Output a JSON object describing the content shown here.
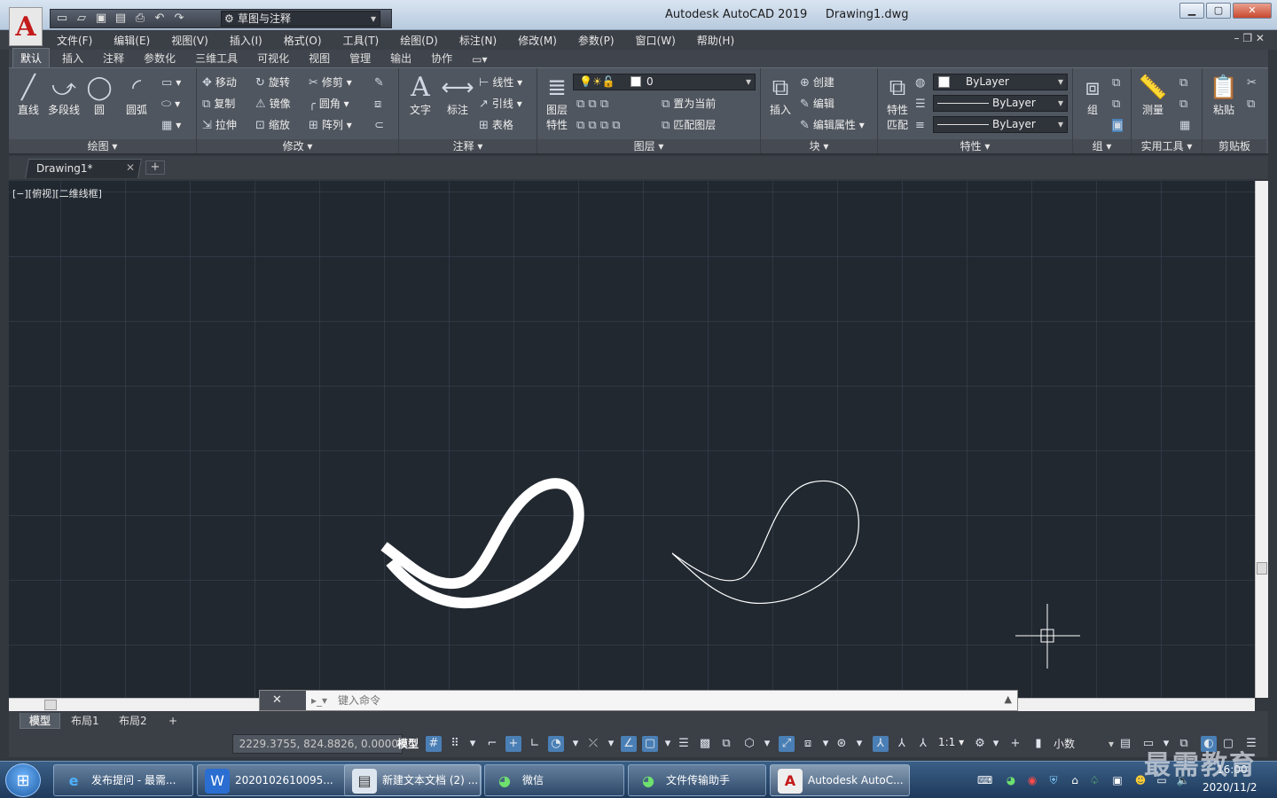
{
  "titlebar": {
    "workspace": "草图与注释",
    "app_title": "Autodesk AutoCAD 2019",
    "file_name": "Drawing1.dwg"
  },
  "menu": [
    "文件(F)",
    "编辑(E)",
    "视图(V)",
    "插入(I)",
    "格式(O)",
    "工具(T)",
    "绘图(D)",
    "标注(N)",
    "修改(M)",
    "参数(P)",
    "窗口(W)",
    "帮助(H)"
  ],
  "ribbon_tabs": [
    "默认",
    "插入",
    "注释",
    "参数化",
    "三维工具",
    "可视化",
    "视图",
    "管理",
    "输出",
    "协作"
  ],
  "ribbon": {
    "draw": {
      "title": "绘图 ▾",
      "line": "直线",
      "polyline": "多段线",
      "circle": "圆",
      "arc": "圆弧"
    },
    "modify": {
      "title": "修改 ▾",
      "move": "移动",
      "rotate": "旋转",
      "trim": "修剪",
      "copy": "复制",
      "mirror": "镜像",
      "fillet": "圆角",
      "stretch": "拉伸",
      "scale": "缩放",
      "array": "阵列"
    },
    "annotation": {
      "title": "注释 ▾",
      "text": "文字",
      "dimension": "标注",
      "linear": "线性",
      "leader": "引线",
      "table": "表格"
    },
    "layers": {
      "title": "图层 ▾",
      "properties": "图层\n特性",
      "prop1": "图层",
      "prop2": "特性",
      "current_layer": "0",
      "set_current": "置为当前",
      "match_layer": "匹配图层"
    },
    "block": {
      "title": "块 ▾",
      "insert": "插入",
      "create": "创建",
      "edit": "编辑",
      "edit_attr": "编辑属性"
    },
    "properties": {
      "title": "特性 ▾",
      "match1": "特性",
      "match2": "匹配",
      "color": "ByLayer",
      "linetype": "ByLayer",
      "lineweight": "ByLayer"
    },
    "groups": {
      "title": "组 ▾",
      "group": "组"
    },
    "utilities": {
      "title": "实用工具 ▾",
      "measure": "测量"
    },
    "clipboard": {
      "title": "剪贴板",
      "paste": "粘贴"
    }
  },
  "file_tabs": {
    "doc": "Drawing1*"
  },
  "viewport": {
    "label": "[−][俯视][二维线框]"
  },
  "command_line": {
    "placeholder": "键入命令"
  },
  "layout_tabs": [
    "模型",
    "布局1",
    "布局2"
  ],
  "statusbar": {
    "coords": "2229.3755, 824.8826, 0.0000",
    "model": "模型",
    "scale": "1:1 ▾",
    "units": "小数"
  },
  "taskbar": {
    "items": [
      "发布提问 - 最需...",
      "2020102610095...",
      "新建文本文档 (2) ...",
      "微信",
      "文件传输助手",
      "Autodesk AutoC..."
    ],
    "time": "16:00",
    "date": "2020/11/2"
  },
  "watermark": "最需教育",
  "colors": {
    "canvas_bg": "#212830",
    "accent": "#4a7fb5",
    "autocad_red": "#c41a1a"
  }
}
